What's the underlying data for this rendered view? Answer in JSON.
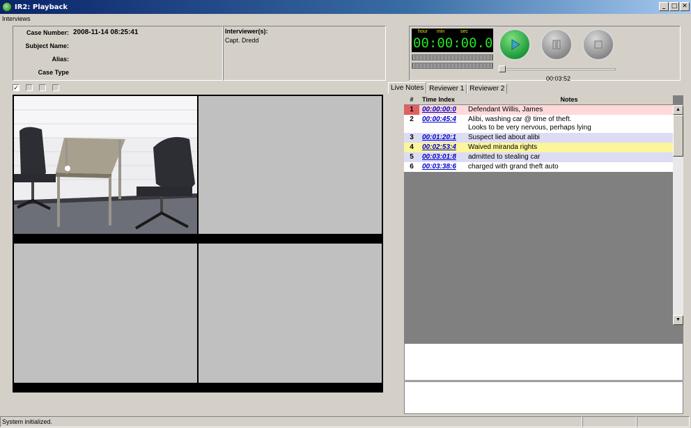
{
  "window": {
    "title": "IR2: Playback"
  },
  "menu": {
    "items": [
      "Interviews"
    ]
  },
  "case": {
    "number_label": "Case Number:",
    "number_value": "2008-11-14 08:25:41",
    "subject_label": "Subject Name:",
    "alias_label": "Alias:",
    "type_label": "Case Type"
  },
  "interviewers": {
    "label": "Interviewer(s):",
    "value": "Capt. Dredd"
  },
  "player": {
    "labels": {
      "hour": "hour",
      "min": "min",
      "sec": "sec"
    },
    "digits": "00:00:00.0",
    "elapsed": "00:03:52",
    "position_fraction": 0.0
  },
  "camera_toggles": [
    true,
    false,
    false,
    false
  ],
  "tabs": [
    "Live Notes",
    "Reviewer 1",
    "Reviewer 2"
  ],
  "notes": {
    "columns": [
      "#",
      "Time Index",
      "Notes"
    ],
    "rows": [
      {
        "num": "1",
        "time": "00:00:00:0",
        "lines": [
          "Defendant  Willis, James"
        ],
        "color": "#ffd9d9",
        "num_color": "#e06060"
      },
      {
        "num": "2",
        "time": "00:00:45:4",
        "lines": [
          "Alibi, washing car @ time of theft.",
          "Looks to be very nervous, perhaps lying"
        ],
        "color": "#ffffff",
        "num_color": "#ffffff"
      },
      {
        "num": "3",
        "time": "00:01:20:1",
        "lines": [
          "Suspect lied about alibi"
        ],
        "color": "#dcdcf4",
        "num_color": "#dcdcf4"
      },
      {
        "num": "4",
        "time": "00:02:53:4",
        "lines": [
          "Waived miranda rights"
        ],
        "color": "#fbf59c",
        "num_color": "#fbf59c"
      },
      {
        "num": "5",
        "time": "00:03:01:8",
        "lines": [
          "admitted to stealing car"
        ],
        "color": "#dcdcf4",
        "num_color": "#dcdcf4"
      },
      {
        "num": "6",
        "time": "00:03:38:6",
        "lines": [
          "charged with grand theft auto"
        ],
        "color": "#ffffff",
        "num_color": "#ffffff"
      }
    ]
  },
  "status": {
    "message": "System initialized."
  },
  "colors": {
    "accent": "#0a246a",
    "timer_digits": "#21e321",
    "play": "#1e9a3a"
  }
}
